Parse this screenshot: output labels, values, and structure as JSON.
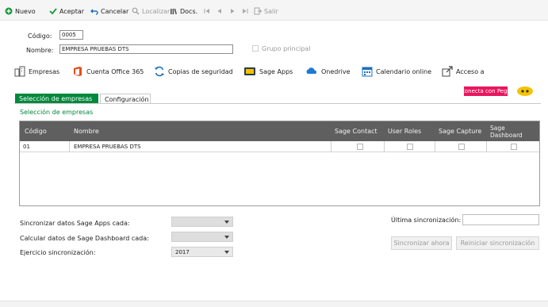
{
  "toolbar": {
    "nuevo": "Nuevo",
    "aceptar": "Aceptar",
    "cancelar": "Cancelar",
    "localizar": "Localizar",
    "docs": "Docs.",
    "salir": "Salir"
  },
  "form": {
    "codigo_label": "Código:",
    "codigo_value": "0005",
    "nombre_label": "Nombre:",
    "nombre_value": "EMPRESA PRUEBAS DTS",
    "grupo_principal_label": "Grupo principal",
    "grupo_principal_checked": false
  },
  "apps": {
    "empresas": "Empresas",
    "office": "Cuenta Office 365",
    "copias": "Copias de seguridad",
    "sage_apps": "Sage Apps",
    "onedrive": "Onedrive",
    "calendario": "Calendario online",
    "acceso": "Acceso a"
  },
  "pegi": {
    "badge": "Conecta con Pegg"
  },
  "tabs": {
    "seleccion": "Selección de empresas",
    "configuracion": "Configuración",
    "active": "seleccion"
  },
  "section": {
    "title": "Selección de empresas"
  },
  "grid": {
    "headers": {
      "codigo": "Código",
      "nombre": "Nombre",
      "sage_contact": "Sage Contact",
      "user_roles": "User Roles",
      "sage_capture": "Sage Capture",
      "sage_dashboard": "Sage Dashboard"
    },
    "rows": [
      {
        "codigo": "01",
        "nombre": "EMPRESA PRUEBAS DTS",
        "sage_contact": false,
        "user_roles": false,
        "sage_capture": false,
        "sage_dashboard": false
      }
    ]
  },
  "sync": {
    "sage_apps_label": "Sincronizar datos Sage Apps cada:",
    "sage_apps_value": "",
    "dashboard_label": "Calcular datos de Sage Dashboard cada:",
    "dashboard_value": "",
    "ejercicio_label": "Ejercicio sincronización:",
    "ejercicio_value": "2017",
    "ultima_label": "Última sincronización:",
    "ultima_value": "",
    "sincronizar_button": "Sincronizar ahora",
    "reiniciar_button": "Reiniciar sincronización"
  },
  "colors": {
    "accent_green": "#00883c",
    "grid_header": "#5f5f5f",
    "pegi_pink": "#e8175d"
  }
}
